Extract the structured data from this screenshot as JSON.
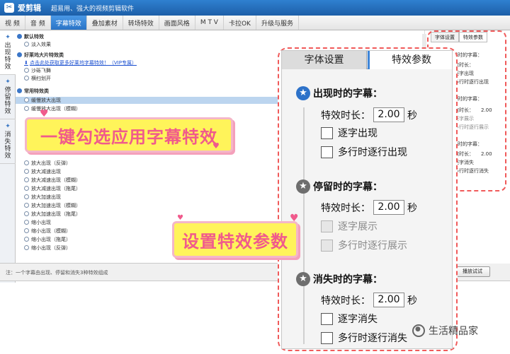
{
  "app": {
    "logo_glyph": "✂",
    "name": "爱剪辑",
    "slogan": "超易用、强大的视频剪辑软件"
  },
  "menu": [
    "视 频",
    "音 频",
    "字幕特效",
    "叠加素材",
    "转场特效",
    "画面风格",
    "M T V",
    "卡拉OK",
    "升级与服务"
  ],
  "menu_active_index": 2,
  "left_tabs": [
    {
      "label": [
        "出",
        "现",
        "特",
        "效"
      ],
      "active": true
    },
    {
      "label": [
        "停",
        "留",
        "特",
        "效"
      ],
      "active": false
    },
    {
      "label": [
        "消",
        "失",
        "特",
        "效"
      ],
      "active": false
    }
  ],
  "effect_list": {
    "group_default": "默认特效",
    "item_fade": "淡入效果",
    "group_hollywood": "好莱坞大片特效类",
    "hollywood_link": "点击此处获取更多好莱坞字幕特效！（VIP专属）",
    "item_sand": "沙砾飞舞",
    "item_wave": "横扫划开",
    "group_common": "常用特效类",
    "item_selected": "缓慢放大出现",
    "item_2": "缓慢放大出现（模糊）",
    "items_lower": [
      "放大出现（反弹）",
      "放大减速出现",
      "放大减速出现（模糊）",
      "放大减速出现（拖尾）",
      "放大加速出现",
      "放大加速出现（模糊）",
      "放大加速出现（拖尾）",
      "缩小出现",
      "缩小出现（模糊）",
      "缩小出现（拖尾）",
      "缩小出现（反弹）"
    ]
  },
  "status_text": "注：一个字幕由出现、停留和消失3种特效组成",
  "bg_panel": {
    "tab_font": "字体设置",
    "tab_effect": "特效参数",
    "appear_title": "现时的字幕：",
    "appear_duration": "效时长：",
    "appear_value": "2.00",
    "appear_opt1": "逐字出现",
    "appear_opt2": "多行时逐行出现",
    "stay_title": "留时的字幕：",
    "stay_duration": "效时长：",
    "stay_value": "2.00",
    "stay_opt1": "逐字展示",
    "stay_opt2": "多行时逐行展示",
    "vanish_title": "失时的字幕：",
    "vanish_duration": "效时长：",
    "vanish_value": "2.00",
    "vanish_opt1": "逐字消失",
    "vanish_opt2": "多行时逐行消失",
    "trial_button": "播放试试"
  },
  "zoom_panel": {
    "tab_font": "字体设置",
    "tab_effect": "特效参数",
    "appear": {
      "title": "出现时的字幕：",
      "duration_label": "特效时长：",
      "duration_value": "2.00",
      "unit": "秒",
      "opt1": "逐字出现",
      "opt2": "多行时逐行出现"
    },
    "stay": {
      "title": "停留时的字幕：",
      "duration_label": "特效时长：",
      "duration_value": "2.00",
      "unit": "秒",
      "opt1": "逐字展示",
      "opt2": "多行时逐行展示"
    },
    "vanish": {
      "title": "消失时的字幕：",
      "duration_label": "特效时长：",
      "duration_value": "2.00",
      "unit": "秒",
      "opt1": "逐字消失",
      "opt2": "多行时逐行消失"
    }
  },
  "callouts": {
    "one_click": "一键勾选应用字幕特效",
    "set_params": "设置特效参数"
  },
  "watermark": "生活精品家",
  "colors": {
    "accent_blue": "#2f80d0",
    "callout_yellow": "#fff45a",
    "callout_text_pink": "#f05a8c",
    "dash_red": "#f05a5a",
    "selected_row": "#bcd5ef"
  }
}
